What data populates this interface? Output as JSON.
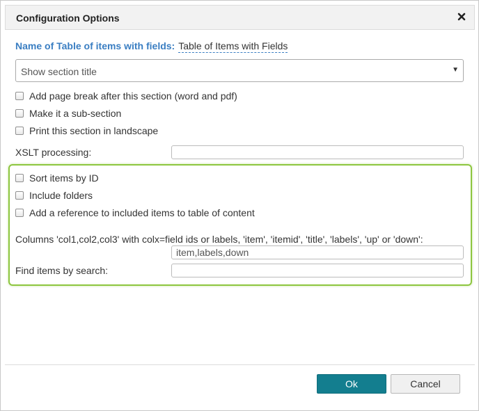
{
  "dialog": {
    "title": "Configuration Options",
    "close_icon": "close-icon"
  },
  "heading": {
    "label": "Name of Table of items with fields:",
    "value": "Table of Items with Fields"
  },
  "section_title_select": {
    "selected": "Show section title"
  },
  "options": [
    {
      "label": "Add page break after this section (word and pdf)",
      "checked": false
    },
    {
      "label": "Make it a sub-section",
      "checked": false
    },
    {
      "label": "Print this section in landscape",
      "checked": false
    }
  ],
  "xslt": {
    "label": "XSLT processing:",
    "value": ""
  },
  "table_options": [
    {
      "label": "Sort items by ID",
      "checked": false
    },
    {
      "label": "Include folders",
      "checked": false
    },
    {
      "label": "Add a reference to included items to table of content",
      "checked": false
    }
  ],
  "columns": {
    "label": "Columns 'col1,col2,col3' with colx=field ids or labels, 'item', 'itemid', 'title', 'labels', 'up' or 'down':",
    "value": "item,labels,down"
  },
  "search": {
    "label": "Find items by search:",
    "value": ""
  },
  "buttons": {
    "ok": "Ok",
    "cancel": "Cancel"
  },
  "colors": {
    "heading_blue": "#3a7ec2",
    "highlight_green": "#8dc63f",
    "ok_button": "#137e8f"
  }
}
